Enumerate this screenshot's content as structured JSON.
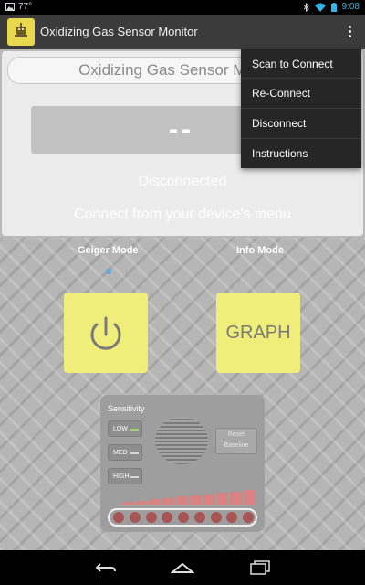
{
  "statusbar": {
    "temperature": "77°",
    "time": "9:08"
  },
  "appbar": {
    "title": "Oxidizing Gas Sensor Monitor"
  },
  "menu": {
    "items": [
      "Scan to Connect",
      "Re-Connect",
      "Disconnect",
      "Instructions"
    ]
  },
  "panel": {
    "title": "Oxidizing Gas Sensor Monitor",
    "reading": "--",
    "status": "Disconnected",
    "hint": "Connect from your device's menu"
  },
  "modes": {
    "geiger": "Geiger Mode",
    "info": "Info Mode",
    "graph_button": "GRAPH"
  },
  "sensitivity": {
    "label": "Sensitivity",
    "levels": [
      {
        "label": "LOW",
        "active": true
      },
      {
        "label": "MED",
        "active": false
      },
      {
        "label": "HIGH",
        "active": false
      }
    ],
    "reset_label": "Reset Baseline",
    "meter_segments": 10,
    "led_count": 9
  },
  "colors": {
    "yellow_button": "#f0ee7a",
    "led": "#a65454",
    "meter": "#d98282",
    "indicator_on": "#8fe05a"
  },
  "icons": [
    "image-icon",
    "bluetooth-icon",
    "wifi-icon",
    "battery-icon",
    "power-icon",
    "back-icon",
    "home-icon",
    "recents-icon"
  ]
}
